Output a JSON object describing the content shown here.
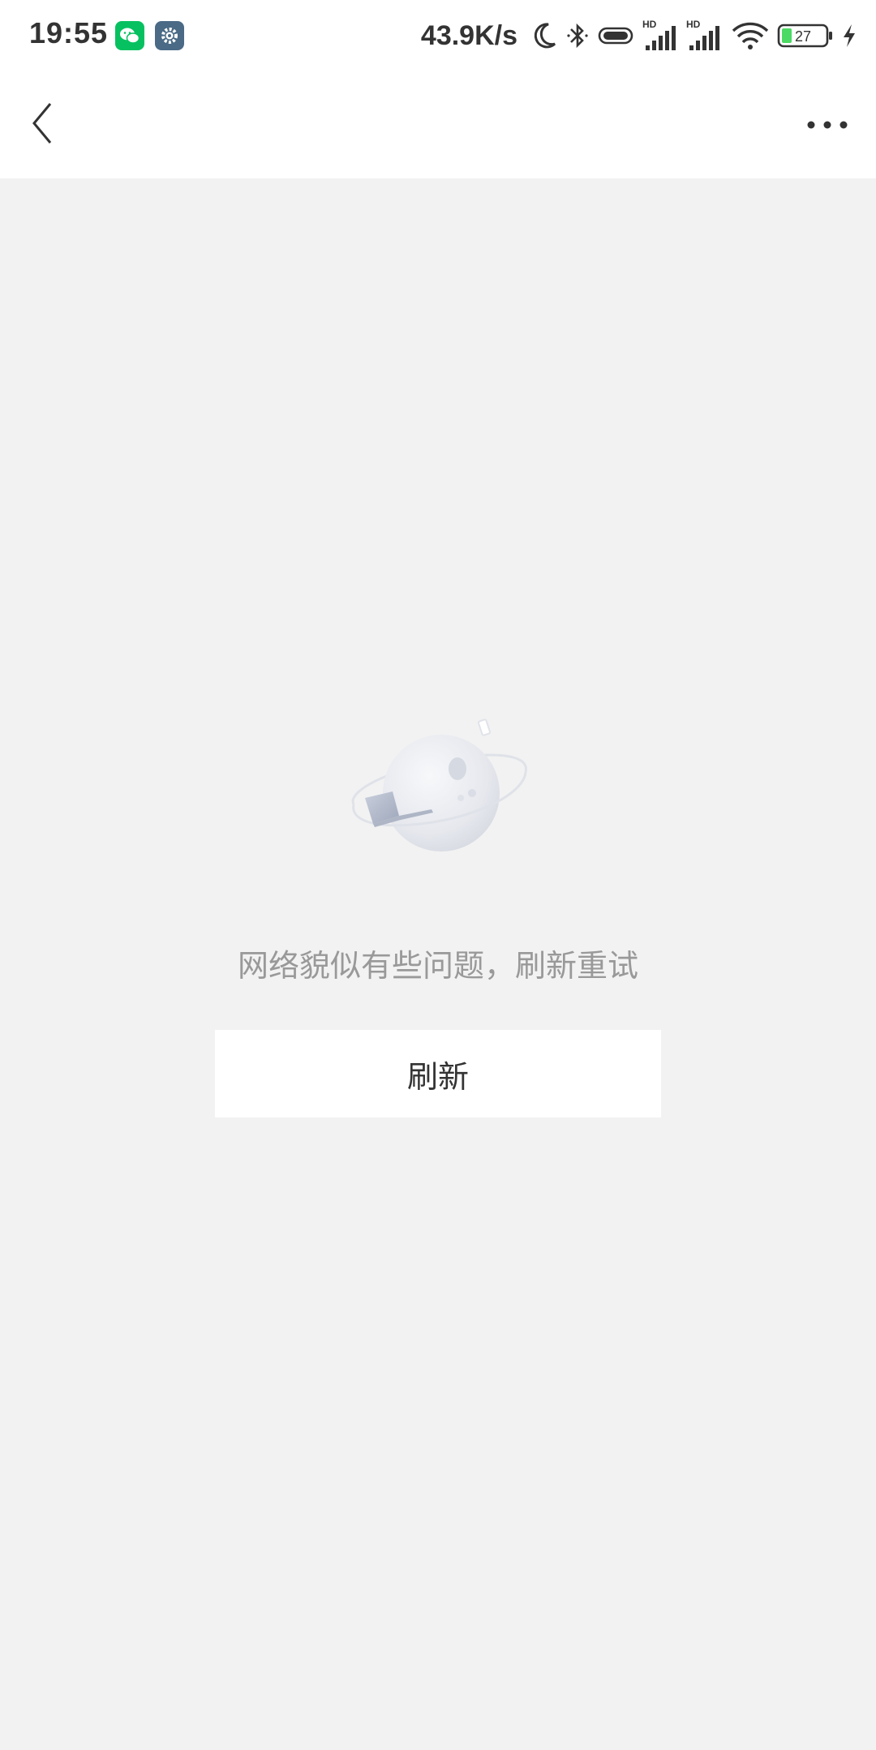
{
  "status_bar": {
    "time": "19:55",
    "net_speed": "43.9K/s",
    "battery_level": "27",
    "icons": [
      "wechat-icon",
      "settings-icon",
      "moon-icon",
      "bluetooth-icon",
      "vibrate-icon",
      "hd-signal-icon",
      "hd-signal-icon",
      "wifi-icon",
      "battery-icon",
      "charging-icon"
    ],
    "colors": {
      "wechat": "#07c160",
      "settings": "#4a6a86",
      "battery_fill": "#4cd964"
    }
  },
  "nav": {
    "back_icon": "chevron-left-icon",
    "more_icon": "more-dots-icon"
  },
  "content": {
    "illustration_icon": "planet-laptop-illustration",
    "error_message": "网络貌似有些问题，刷新重试",
    "refresh_label": "刷新"
  }
}
